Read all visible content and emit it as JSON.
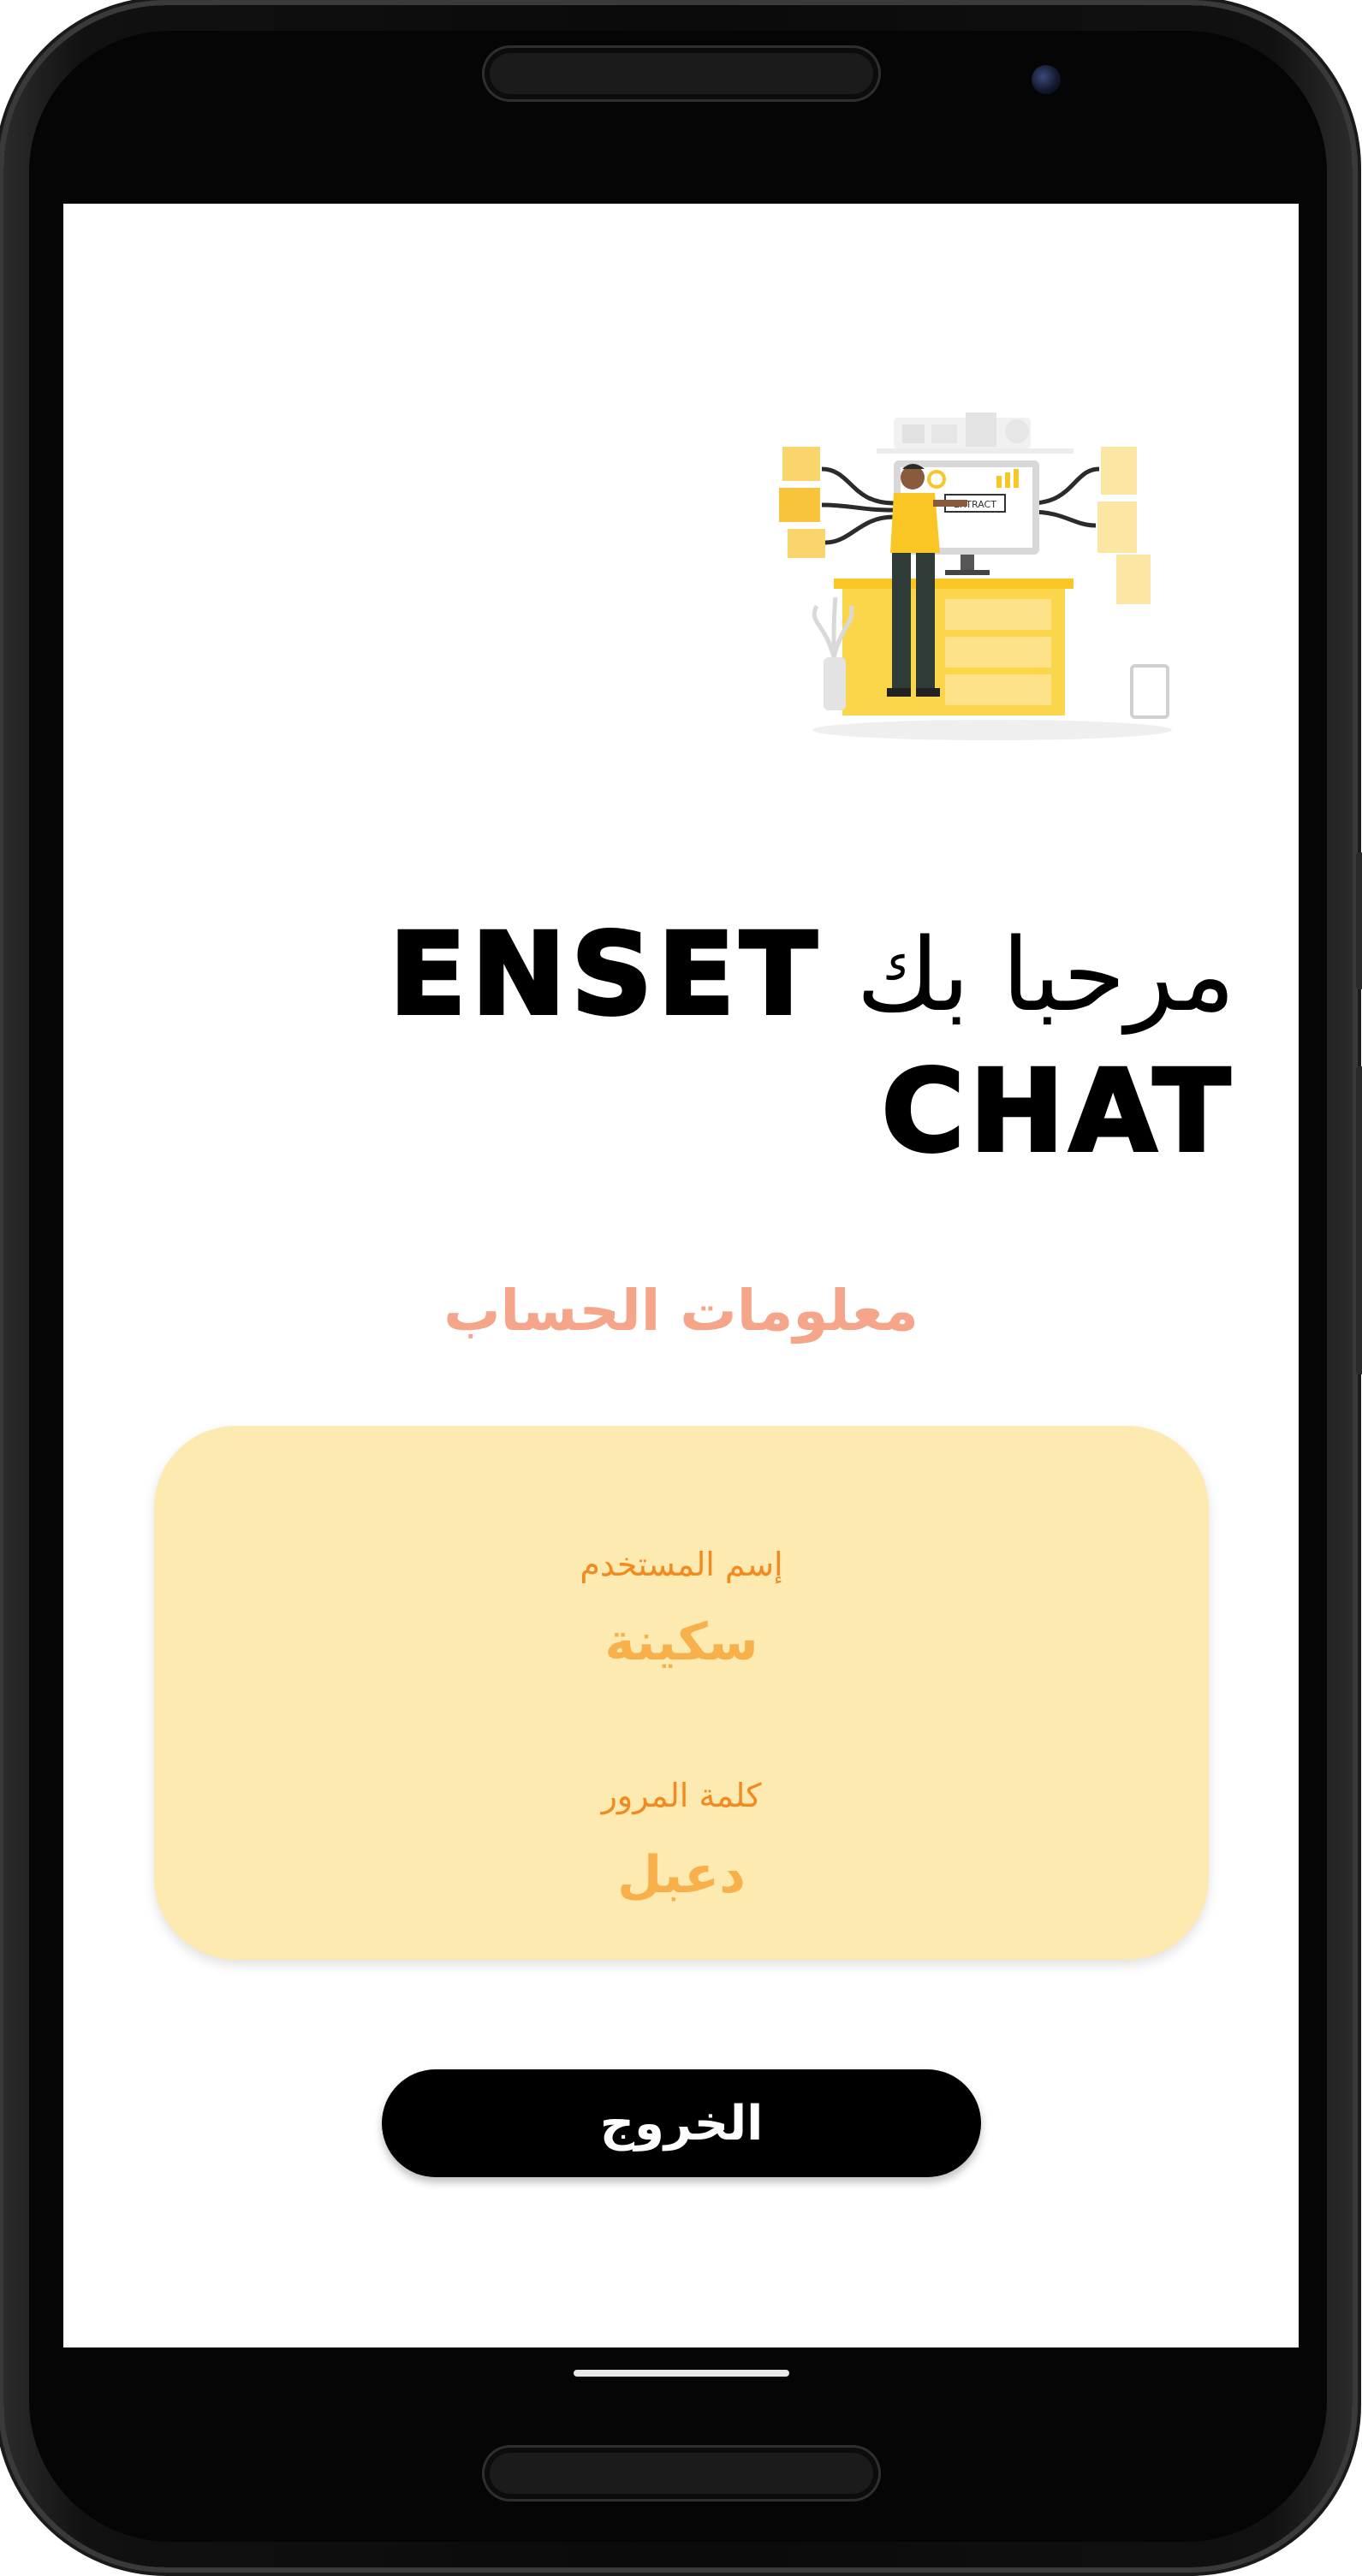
{
  "welcome": {
    "arabic": "مرحبا بك",
    "app_name_part1": "ENSET",
    "app_name_part2": "CHAT"
  },
  "account": {
    "section_title": "معلومات الحساب",
    "username_label": "إسم المستخدم",
    "username_value": "سكينة",
    "password_label": "كلمة المرور",
    "password_value": "دعبل"
  },
  "actions": {
    "logout_label": "الخروج"
  },
  "illustration": {
    "icon": "data-extract-illustration",
    "screen_text": "EXTRACT"
  },
  "colors": {
    "section_title": "#f5a58a",
    "card_background": "#fdeab1",
    "label": "#f28a1f",
    "value": "#f7b04a",
    "button": "#000000",
    "accent_yellow": "#f9c623"
  }
}
